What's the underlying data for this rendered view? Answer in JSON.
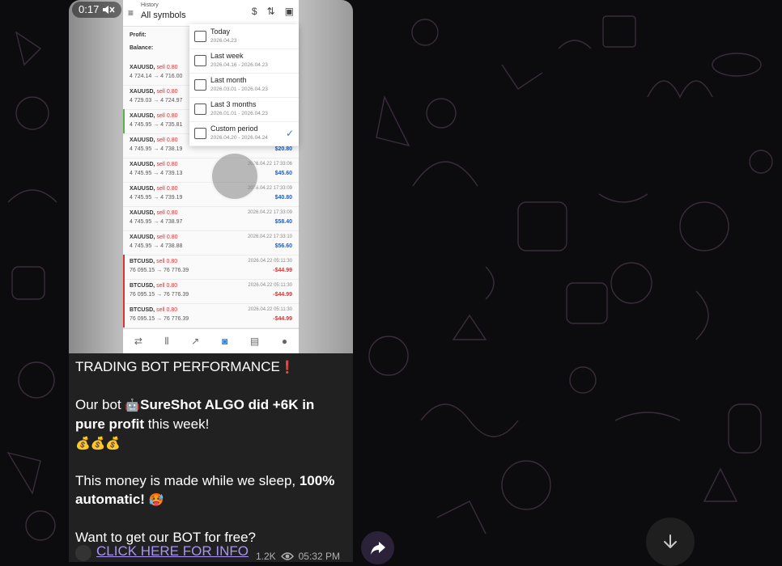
{
  "video": {
    "duration": "0:17",
    "mute_icon": "speaker-muted-icon"
  },
  "phone": {
    "header_small": "History",
    "header_title": "All symbols",
    "profit_label": "Profit:",
    "balance_label": "Balance:",
    "dropdown": [
      {
        "label": "Today",
        "range": "2026.04.23"
      },
      {
        "label": "Last week",
        "range": "2026.04.16 - 2026.04.23"
      },
      {
        "label": "Last month",
        "range": "2026.03.01 - 2026.04.23"
      },
      {
        "label": "Last 3 months",
        "range": "2026.01.01 - 2026.04.23"
      },
      {
        "label": "Custom period",
        "range": "2026.04.20 - 2026.04.24"
      }
    ],
    "trades": [
      {
        "symbol": "XAUUSD,",
        "side": "sell 0.80",
        "prices": "4 724.14 → 4 716.00",
        "date": "",
        "profit": ""
      },
      {
        "symbol": "XAUUSD,",
        "side": "sell 0.80",
        "prices": "4 729.03 → 4 724.97",
        "date": "",
        "profit": ""
      },
      {
        "symbol": "XAUUSD,",
        "side": "sell 0.80",
        "prices": "4 745.95 → 4 735.81",
        "date": "",
        "profit": ""
      },
      {
        "symbol": "XAUUSD,",
        "side": "sell 0.80",
        "prices": "4 745.95 → 4 738.19",
        "date": "",
        "profit": "$20.80"
      },
      {
        "symbol": "XAUUSD,",
        "side": "sell 0.80",
        "prices": "4 745.95 → 4 739.13",
        "date": "2026.04.22 17:33:06",
        "profit": "$45.60"
      },
      {
        "symbol": "XAUUSD,",
        "side": "sell 0.80",
        "prices": "4 745.95 → 4 739.19",
        "date": "2026.04.22 17:33:09",
        "profit": "$40.80"
      },
      {
        "symbol": "XAUUSD,",
        "side": "sell 0.80",
        "prices": "4 745.95 → 4 738.97",
        "date": "2026.04.22 17:33:09",
        "profit": "$58.40"
      },
      {
        "symbol": "XAUUSD,",
        "side": "sell 0.80",
        "prices": "4 745.95 → 4 738.88",
        "date": "2026.04.22 17:33:10",
        "profit": "$56.60"
      },
      {
        "symbol": "BTCUSD,",
        "side": "sell 0.80",
        "prices": "76 095.15 → 76 776.39",
        "date": "2026.04.22 05:11:30",
        "profit": "-$44.99"
      },
      {
        "symbol": "BTCUSD,",
        "side": "sell 0.80",
        "prices": "76 095.15 → 76 776.39",
        "date": "2026.04.22 05:11:30",
        "profit": "-$44.99"
      },
      {
        "symbol": "BTCUSD,",
        "side": "sell 0.80",
        "prices": "76 095.15 → 76 776.39",
        "date": "2026.04.22 05:11:30",
        "profit": "-$44.99"
      }
    ]
  },
  "message": {
    "title": "TRADING BOT PERFORMANCE",
    "line2_a": "Our bot ",
    "line2_bold": "SureShot ALGO did +6K in pure profit",
    "line2_b": " this week!",
    "emoji_line": "💰💰💰",
    "line4_a": "This money is made while we sleep, ",
    "line4_bold": "100% automatic!",
    "line5": "Want to get our BOT for free?",
    "link": "CLICK HERE FOR INFO",
    "views": "1.2K",
    "time": "05:32 PM"
  },
  "colors": {
    "bubble": "#212121",
    "link": "#a993f5",
    "background": "#0c0c0e"
  }
}
